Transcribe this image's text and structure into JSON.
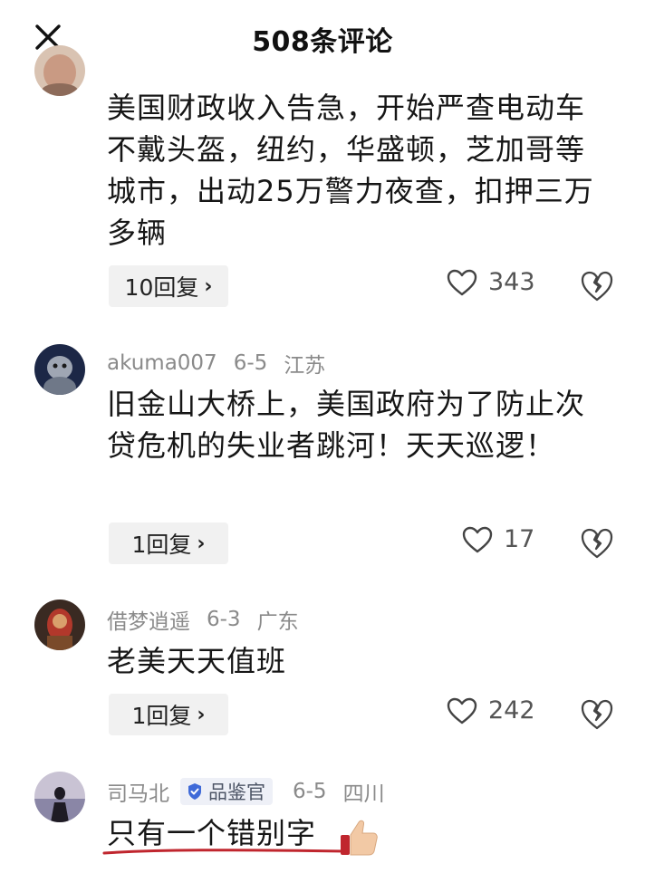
{
  "header": {
    "title": "508条评论"
  },
  "comments": [
    {
      "text": "美国财政收入告急，开始严查电动车不戴头盔，纽约，华盛顿，芝加哥等城市，出动25万警力夜查，扣押三万多辆",
      "reply_label": "10回复",
      "likes": "343"
    },
    {
      "username": "akuma007",
      "date": "6-5",
      "location": "江苏",
      "text": "旧金山大桥上，美国政府为了防止次贷危机的失业者跳河！天天巡逻！",
      "reply_label": "1回复",
      "likes": "17"
    },
    {
      "username": "借梦逍遥",
      "date": "6-3",
      "location": "广东",
      "text": "老美天天值班",
      "reply_label": "1回复",
      "likes": "242"
    },
    {
      "username": "司马北",
      "badge": "品鉴官",
      "date": "6-5",
      "location": "四川",
      "text": "只有一个错别字"
    }
  ],
  "colors": {
    "underline": "#c0262e",
    "meta": "#8a8a8a",
    "reply_bg": "#f1f1f1",
    "badge_icon": "#3f6ad8"
  },
  "icons": [
    "close-icon",
    "heart-outline-icon",
    "broken-heart-icon",
    "verified-badge-icon",
    "thumbs-up-emoji"
  ]
}
